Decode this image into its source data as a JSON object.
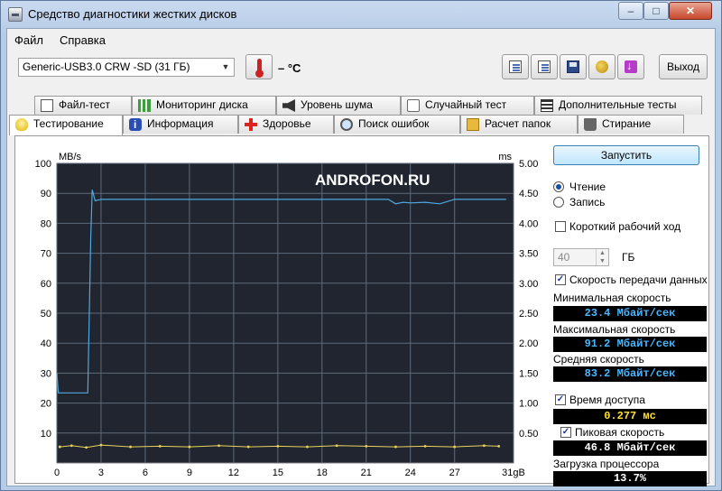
{
  "window": {
    "title": "Средство диагностики жестких дисков",
    "min": "–",
    "max": "□",
    "close": "✕"
  },
  "menu": [
    "Файл",
    "Справка"
  ],
  "toolbar": {
    "drive": "Generic-USB3.0 CRW   -SD (31 ГБ)",
    "temperature": "– °C",
    "exit_label": "Выход",
    "icons": [
      "copy-text-icon",
      "copy-image-icon",
      "save-icon",
      "coins-icon",
      "download-icon"
    ]
  },
  "tabs_top": [
    {
      "label": "Файл-тест",
      "icon": "doc-icon"
    },
    {
      "label": "Мониторинг диска",
      "icon": "chart-icon"
    },
    {
      "label": "Уровень шума",
      "icon": "speaker-icon"
    },
    {
      "label": "Случайный тест",
      "icon": "dice-icon"
    },
    {
      "label": "Дополнительные тесты",
      "icon": "list-icon"
    }
  ],
  "tabs_bottom": [
    {
      "label": "Тестирование",
      "icon": "bulb-icon",
      "active": true
    },
    {
      "label": "Информация",
      "icon": "info-icon"
    },
    {
      "label": "Здоровье",
      "icon": "health-cross-icon"
    },
    {
      "label": "Поиск ошибок",
      "icon": "magnifier-icon"
    },
    {
      "label": "Расчет папок",
      "icon": "folder-icon"
    },
    {
      "label": "Стирание",
      "icon": "trash-icon"
    }
  ],
  "watermark": "ANDROFON.RU",
  "chart_data": {
    "type": "line",
    "ylabel_left": "MB/s",
    "ylabel_right": "ms",
    "x_ticks": [
      "0",
      "3",
      "6",
      "9",
      "12",
      "15",
      "18",
      "21",
      "24",
      "27",
      "31gB"
    ],
    "y_left_ticks": [
      "10",
      "20",
      "30",
      "40",
      "50",
      "60",
      "70",
      "80",
      "90",
      "100"
    ],
    "y_right_ticks": [
      "0.50",
      "1.00",
      "1.50",
      "2.00",
      "2.50",
      "3.00",
      "3.50",
      "4.00",
      "4.50",
      "5.00"
    ],
    "xlim": [
      0,
      31
    ],
    "ylim_left": [
      0,
      100
    ],
    "ylim_right": [
      0,
      5
    ],
    "grid": true,
    "series": [
      {
        "name": "Скорость передачи данных",
        "color": "#4fa8e0",
        "x": [
          0,
          0.1,
          2.1,
          2.3,
          2.4,
          2.6,
          3,
          6,
          9,
          12,
          15,
          18,
          21,
          22.5,
          23,
          23.5,
          24,
          25,
          26,
          27,
          28,
          30,
          30.5
        ],
        "y": [
          30,
          23.4,
          23.4,
          75,
          91.2,
          87.5,
          88,
          88,
          88,
          88,
          88,
          88,
          88,
          88,
          86.5,
          87,
          86.8,
          87,
          86.5,
          88,
          88,
          88,
          88
        ]
      },
      {
        "name": "Время доступа",
        "color": "#e8d35a",
        "x": [
          0.2,
          1,
          2,
          3,
          5,
          7,
          9,
          11,
          13,
          15,
          17,
          19,
          21,
          23,
          25,
          27,
          29,
          30
        ],
        "y": [
          0.27,
          0.29,
          0.26,
          0.3,
          0.27,
          0.28,
          0.27,
          0.29,
          0.27,
          0.28,
          0.27,
          0.29,
          0.28,
          0.27,
          0.28,
          0.27,
          0.29,
          0.28
        ]
      }
    ]
  },
  "controls": {
    "start_label": "Запустить",
    "read_label": "Чтение",
    "write_label": "Запись",
    "short_stroke_label": "Короткий рабочий ход",
    "short_stroke_value": "40",
    "short_stroke_unit": "ГБ",
    "transfer_rate_label": "Скорость передачи данных",
    "min_label": "Минимальная скорость",
    "min_value": "23.4 Мбайт/сек",
    "max_label": "Максимальная скорость",
    "max_value": "91.2 Мбайт/сек",
    "avg_label": "Средняя скорость",
    "avg_value": "83.2 Мбайт/сек",
    "access_label": "Время доступа",
    "access_value": "0.277 мс",
    "burst_label": "Пиковая скорость",
    "burst_value": "46.8 Мбайт/сек",
    "cpu_label": "Загрузка процессора",
    "cpu_value": "13.7%",
    "value_color": "#49b7ff",
    "access_color": "#ffe033",
    "white_color": "#ffffff"
  }
}
